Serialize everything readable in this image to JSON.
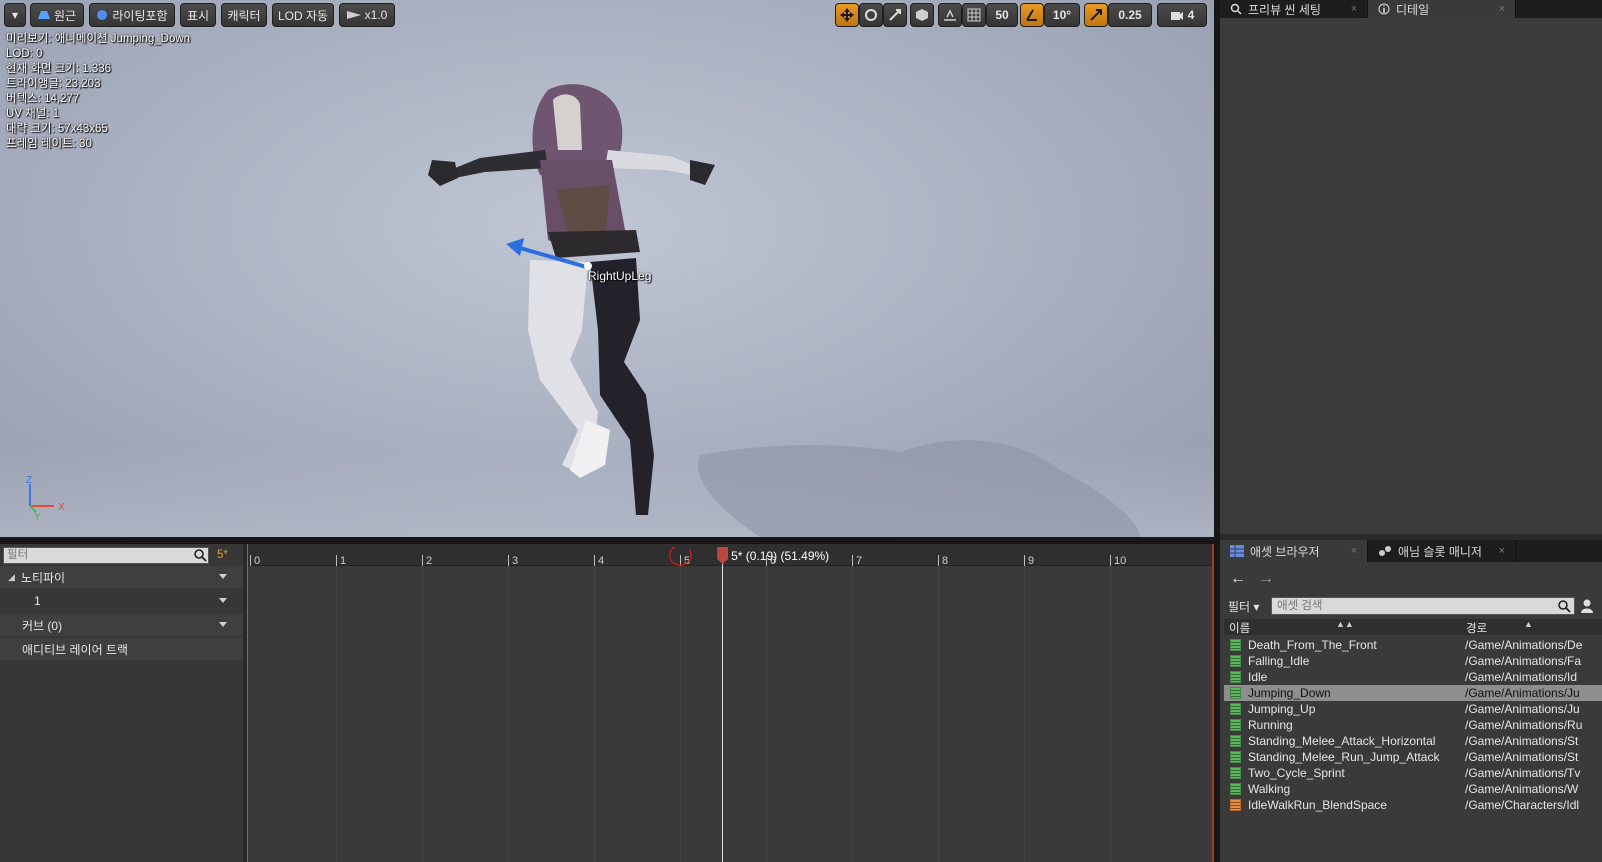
{
  "toolbar": {
    "menu_arrow": "▾",
    "perspective": "원근",
    "lighting": "라이팅포함",
    "show": "표시",
    "character": "캐릭터",
    "lod": "LOD 자동",
    "speed": "x1.0",
    "grid_snap": "50",
    "rotation_snap": "10°",
    "scale_snap": "0.25",
    "camera_speed": "4"
  },
  "stats": [
    "미리보기: 애니메이션 Jumping_Down",
    "LOD: 0",
    "현재 화면 크기: 1.336",
    "트라이앵글: 23,203",
    "버텍스: 14,277",
    "UV 채널: 1",
    "대략 크기: 57x43x65",
    "프레임 레이트: 30"
  ],
  "viewport": {
    "bone_label": "RightUpLeg",
    "axis": {
      "z": "Z",
      "x": "X",
      "y": "Y"
    }
  },
  "details_tabs": [
    {
      "label": "프리뷰 씬 세팅",
      "icon": "search-icon",
      "close": "×"
    },
    {
      "label": "디테일",
      "icon": "info-icon",
      "close": "×"
    }
  ],
  "timeline": {
    "filter_placeholder": "필터",
    "frame_badge": "5*",
    "tracks": [
      {
        "label": "노티파이",
        "dropdown": true
      },
      {
        "label": "1",
        "dropdown": true
      },
      {
        "label": "커브  (0)",
        "dropdown": true
      },
      {
        "label": "애디티브 레이어 트랙",
        "dropdown": false
      }
    ],
    "ruler_labels": [
      "0",
      "1",
      "2",
      "3",
      "4",
      "5",
      "6",
      "7",
      "8",
      "9",
      "10"
    ],
    "playhead_label": "5* (0.19) (51.49%)",
    "playhead_frame": 5.49
  },
  "asset_browser": {
    "tabs": [
      {
        "label": "애셋 브라우저",
        "icon": "grid-icon",
        "close": "×"
      },
      {
        "label": "애님 슬롯 매니저",
        "icon": "anim-slot-icon",
        "close": "×"
      }
    ],
    "back_arrow": "←",
    "forward_arrow": "→",
    "filter_label": "필터 ▾",
    "search_placeholder": "애셋 검색",
    "col_name": "이름",
    "col_path": "경로",
    "sort_name": "▲▲",
    "sort_path": "▲",
    "rows": [
      {
        "name": "Death_From_The_Front",
        "path": "/Game/Animations/De",
        "type": "anim",
        "selected": false
      },
      {
        "name": "Falling_Idle",
        "path": "/Game/Animations/Fa",
        "type": "anim",
        "selected": false
      },
      {
        "name": "Idle",
        "path": "/Game/Animations/Id",
        "type": "anim",
        "selected": false
      },
      {
        "name": "Jumping_Down",
        "path": "/Game/Animations/Ju",
        "type": "anim",
        "selected": true
      },
      {
        "name": "Jumping_Up",
        "path": "/Game/Animations/Ju",
        "type": "anim",
        "selected": false
      },
      {
        "name": "Running",
        "path": "/Game/Animations/Ru",
        "type": "anim",
        "selected": false
      },
      {
        "name": "Standing_Melee_Attack_Horizontal",
        "path": "/Game/Animations/St",
        "type": "anim",
        "selected": false
      },
      {
        "name": "Standing_Melee_Run_Jump_Attack",
        "path": "/Game/Animations/St",
        "type": "anim",
        "selected": false
      },
      {
        "name": "Two_Cycle_Sprint",
        "path": "/Game/Animations/Tv",
        "type": "anim",
        "selected": false
      },
      {
        "name": "Walking",
        "path": "/Game/Animations/W",
        "type": "anim",
        "selected": false
      },
      {
        "name": "IdleWalkRun_BlendSpace",
        "path": "/Game/Characters/Idl",
        "type": "blendspace",
        "selected": false
      }
    ]
  }
}
